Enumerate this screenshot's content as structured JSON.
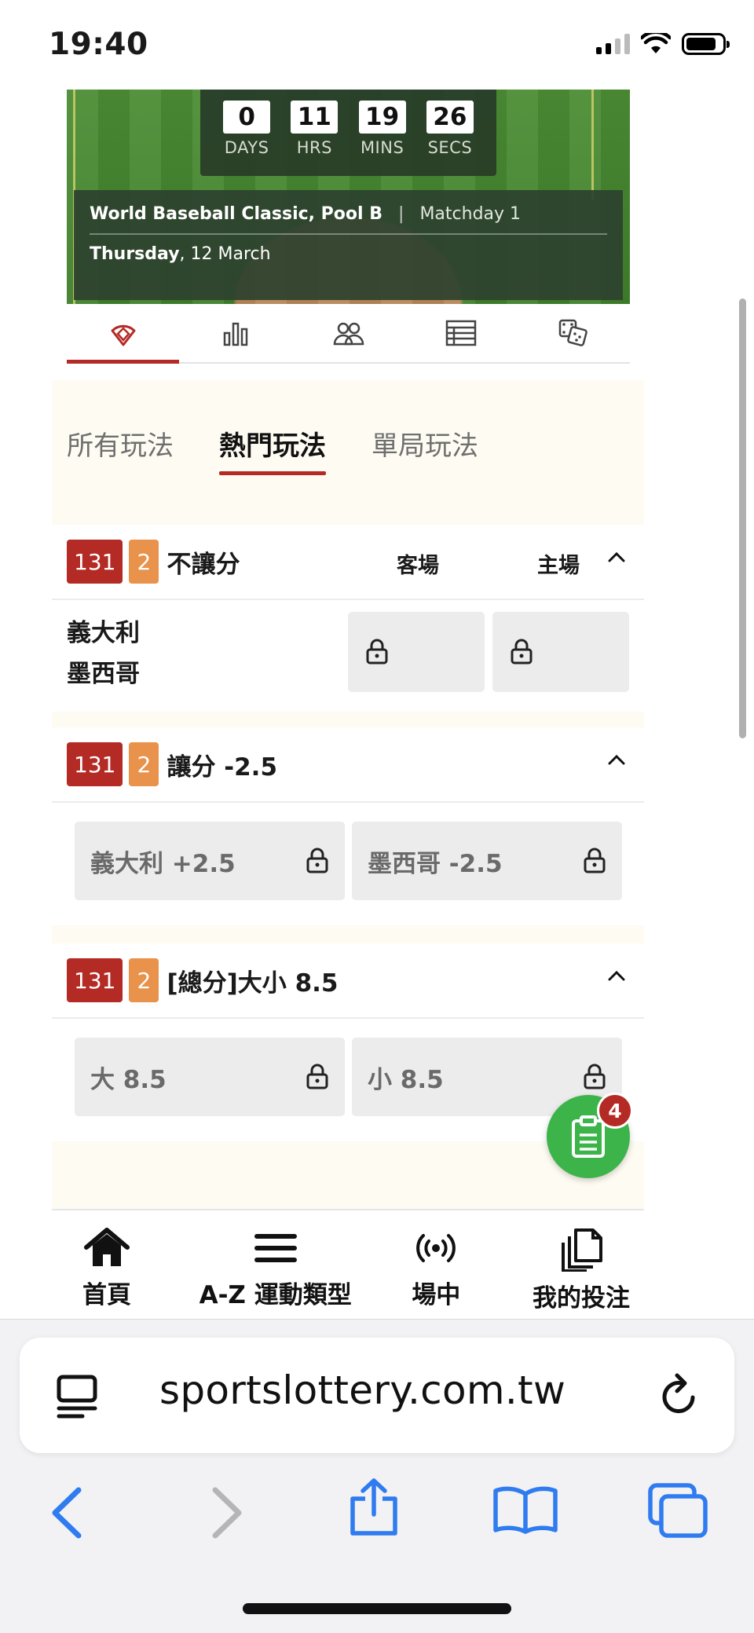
{
  "status_bar": {
    "time": "19:40"
  },
  "hero": {
    "countdown": [
      {
        "value": "0",
        "label": "DAYS"
      },
      {
        "value": "11",
        "label": "HRS"
      },
      {
        "value": "19",
        "label": "MINS"
      },
      {
        "value": "26",
        "label": "SECS"
      }
    ],
    "competition": "World Baseball Classic, Pool B",
    "separator": "|",
    "matchday": "Matchday 1",
    "day": "Thursday",
    "date": ", 12 March"
  },
  "icon_tabs": [
    "baseball-field-icon",
    "stats-bars-icon",
    "lineups-icon",
    "standings-list-icon",
    "dice-icon"
  ],
  "sub_tabs": [
    "所有玩法",
    "熱門玩法",
    "單局玩法"
  ],
  "markets": [
    {
      "code": "131",
      "period": "2",
      "title": "不讓分",
      "col_away": "客場",
      "col_home": "主場",
      "team_top": "義大利",
      "team_bottom": "墨西哥"
    },
    {
      "code": "131",
      "period": "2",
      "title": "讓分 -2.5",
      "options": [
        "義大利 +2.5",
        "墨西哥 -2.5"
      ]
    },
    {
      "code": "131",
      "period": "2",
      "title": "[總分]大小 8.5",
      "options": [
        "大 8.5",
        "小 8.5"
      ]
    }
  ],
  "betslip": {
    "count": "4"
  },
  "bottom_nav": [
    {
      "label": "首頁",
      "icon": "home-icon"
    },
    {
      "label": "A-Z 運動類型",
      "icon": "menu-icon"
    },
    {
      "label": "場中",
      "icon": "live-broadcast-icon"
    },
    {
      "label": "我的投注",
      "icon": "my-bets-icon"
    }
  ],
  "browser": {
    "url": "sportslottery.com.tw"
  },
  "colors": {
    "accent_red": "#b42a25",
    "badge_orange": "#e8924b",
    "fab_green": "#3cb44a",
    "ios_blue": "#2f7bf0"
  }
}
